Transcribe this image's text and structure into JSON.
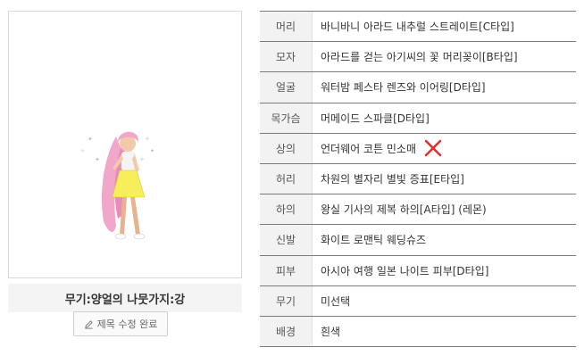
{
  "preview": {
    "caption": "무기:양얼의 나뭇가지:강",
    "edit_label": "제목 수정 완료",
    "edit_icon": "pencil-icon"
  },
  "equipment": [
    {
      "key": "머리",
      "value": "바니바니 아라드 내추럴 스트레이트[C타입]"
    },
    {
      "key": "모자",
      "value": "아라드를 걷는 아기씨의 꽃 머리꽂이[B타입]"
    },
    {
      "key": "얼굴",
      "value": "워터밤 페스타 렌즈와 이어링[D타입]"
    },
    {
      "key": "목가슴",
      "value": "머메이드 스파클[D타입]"
    },
    {
      "key": "상의",
      "value": "언더웨어 코튼 민소매",
      "mark": "x-mark-icon",
      "mark_color": "#e03030"
    },
    {
      "key": "허리",
      "value": "차원의 별자리 별빛 증표[E타입]"
    },
    {
      "key": "하의",
      "value": "왕실 기사의 제복 하의[A타입] (레몬)"
    },
    {
      "key": "신발",
      "value": "화이트 로맨틱 웨딩슈즈"
    },
    {
      "key": "피부",
      "value": "아시아 여행 일본 나이트 피부[D타입]"
    },
    {
      "key": "무기",
      "value": "미선택"
    },
    {
      "key": "배경",
      "value": "흰색"
    }
  ]
}
